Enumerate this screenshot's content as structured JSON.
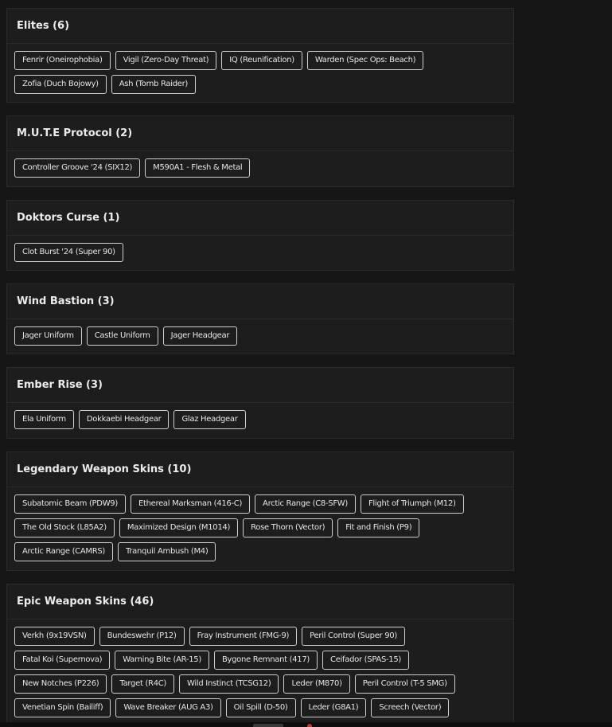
{
  "sections": [
    {
      "title": "Elites (6)",
      "items": [
        "Fenrir (Oneirophobia)",
        "Vigil (Zero-Day Threat)",
        "IQ (Reunification)",
        "Warden (Spec Ops: Beach)",
        "Zofia (Duch Bojowy)",
        "Ash (Tomb Raider)"
      ]
    },
    {
      "title": "M.U.T.E Protocol (2)",
      "items": [
        "Controller Groove '24 (SIX12)",
        "M590A1 - Flesh & Metal"
      ]
    },
    {
      "title": "Doktors Curse (1)",
      "items": [
        "Clot Burst '24 (Super 90)"
      ]
    },
    {
      "title": "Wind Bastion (3)",
      "items": [
        "Jager Uniform",
        "Castle Uniform",
        "Jager Headgear"
      ]
    },
    {
      "title": "Ember Rise (3)",
      "items": [
        "Ela Uniform",
        "Dokkaebi Headgear",
        "Glaz Headgear"
      ]
    },
    {
      "title": "Legendary Weapon Skins (10)",
      "items": [
        "Subatomic Beam (PDW9)",
        "Ethereal Marksman (416-C)",
        "Arctic Range (C8-SFW)",
        "Flight of Triumph (M12)",
        "The Old Stock (L85A2)",
        "Maximized Design (M1014)",
        "Rose Thorn (Vector)",
        "Fit and Finish (P9)",
        "Arctic Range (CAMRS)",
        "Tranquil Ambush (M4)"
      ]
    },
    {
      "title": "Epic Weapon Skins (46)",
      "items": [
        "Verkh (9x19VSN)",
        "Bundeswehr (P12)",
        "Fray Instrument (FMG-9)",
        "Peril Control (Super 90)",
        "Fatal Koi (Supernova)",
        "Warning Bite (AR-15)",
        "Bygone Remnant (417)",
        "Ceifador (SPAS-15)",
        "New Notches (P226)",
        "Target (R4C)",
        "Wild Instinct (TCSG12)",
        "Leder (M870)",
        "Peril Control (T-5 SMG)",
        "Venetian Spin (Bailiff)",
        "Wave Breaker (AUG A3)",
        "Oil Spill (D-50)",
        "Leder (G8A1)",
        "Screech (Vector)"
      ]
    }
  ]
}
